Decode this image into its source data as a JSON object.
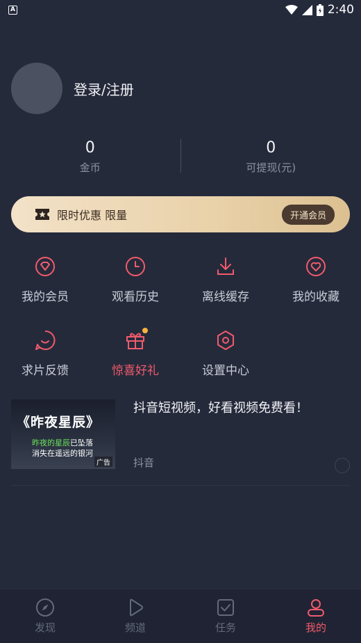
{
  "status": {
    "time": "2:40",
    "left_badge": "A"
  },
  "profile": {
    "login_label": "登录/注册"
  },
  "stats": [
    {
      "value": "0",
      "label": "金币"
    },
    {
      "value": "0",
      "label": "可提现(元)"
    }
  ],
  "vip": {
    "promo": "限时优惠 限量",
    "button": "开通会员"
  },
  "menu_row1": [
    {
      "label": "我的会员",
      "icon": "diamond-icon"
    },
    {
      "label": "观看历史",
      "icon": "clock-icon"
    },
    {
      "label": "离线缓存",
      "icon": "download-icon"
    },
    {
      "label": "我的收藏",
      "icon": "heart-icon"
    }
  ],
  "menu_row2": [
    {
      "label": "求片反馈",
      "icon": "smile-icon"
    },
    {
      "label": "惊喜好礼",
      "icon": "gift-icon"
    },
    {
      "label": "设置中心",
      "icon": "settings-icon"
    }
  ],
  "ad": {
    "thumb_title": "《昨夜星辰》",
    "thumb_line1_highlight": "昨夜的星辰",
    "thumb_line1_rest": "已坠落",
    "thumb_line2": "消失在遥远的银河",
    "thumb_tag": "广告",
    "title": "抖音短视频，好看视频免费看！",
    "source": "抖音"
  },
  "tabs": [
    {
      "label": "发现",
      "icon": "compass-icon",
      "active": false
    },
    {
      "label": "频道",
      "icon": "play-icon",
      "active": false
    },
    {
      "label": "任务",
      "icon": "task-icon",
      "active": false
    },
    {
      "label": "我的",
      "icon": "user-icon",
      "active": true
    }
  ],
  "colors": {
    "accent": "#f05b6b",
    "background": "#252a3b",
    "vip_gold": "#e9d1a9"
  }
}
